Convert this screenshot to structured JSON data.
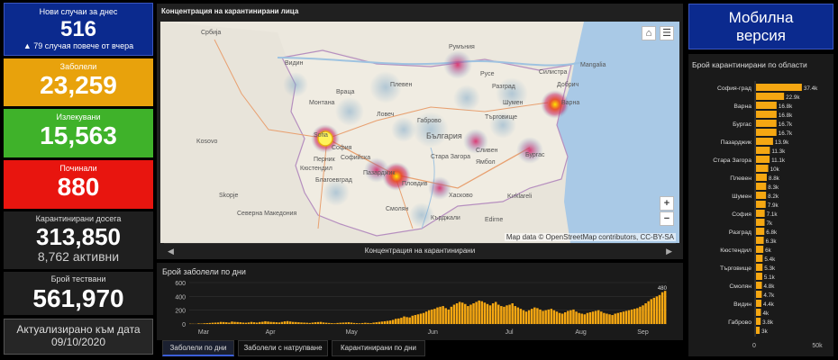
{
  "tiles": {
    "new_cases": {
      "label": "Нови случаи за днес",
      "value": "516",
      "sub": "▲ 79 случая повече от вчера",
      "color": "#0b2a8e"
    },
    "infected": {
      "label": "Заболели",
      "value": "23,259",
      "color": "#e8a20c"
    },
    "recovered": {
      "label": "Излекувани",
      "value": "15,563",
      "color": "#3fb22a"
    },
    "deceased": {
      "label": "Починали",
      "value": "880",
      "color": "#e8150f"
    },
    "quarantined": {
      "label": "Карантинирани досега",
      "value": "313,850",
      "sub": "8,762 активни"
    },
    "tests": {
      "label": "Брой тествани",
      "value": "561,970"
    },
    "updated": {
      "label": "Актуализирано към дата",
      "date": "09/10/2020"
    }
  },
  "map": {
    "title": "Концентрация на карантинирани лица",
    "credit": "Map data © OpenStreetMap contributors, CC-BY-SA",
    "nav_label": "Концентрация на карантинирани",
    "zoom_in": "+",
    "zoom_out": "−",
    "labels": [
      "Србија",
      "Румъния",
      "Плевен",
      "Враца",
      "Русе",
      "Видин",
      "Ловеч",
      "Шумен",
      "Варна",
      "България",
      "София",
      "Пловдив",
      "Бургас",
      "Sofia",
      "Софийска",
      "Kosovo",
      "Skopje",
      "Северна Македония",
      "Kırklareli",
      "Edirne",
      "Благоевград",
      "Хасково",
      "Ямбол",
      "Сливен",
      "Стара Загора",
      "Кюстендил",
      "Перник",
      "Кърджали",
      "Смолян",
      "Пазарджик",
      "Габрово",
      "Монтана",
      "Търговище",
      "Разград",
      "Силистра",
      "Добрич",
      "Mangalia"
    ]
  },
  "daily_chart": {
    "title": "Брой заболели по дни",
    "tabs": [
      "Заболели по дни",
      "Заболели с натрупване",
      "Карантинирани по дни"
    ],
    "active_tab": 0
  },
  "mobile_button": {
    "label_line1": "Мобилна",
    "label_line2": "версия"
  },
  "chart_data": [
    {
      "type": "bar",
      "title": "Брой заболели по дни",
      "x_ticks": [
        "Mar",
        "Apr",
        "May",
        "Jun",
        "Jul",
        "Aug",
        "Sep"
      ],
      "y_ticks": [
        0,
        200,
        400,
        600
      ],
      "ylim": [
        0,
        600
      ],
      "bar_color": "#f5a712",
      "values": [
        4,
        3,
        2,
        8,
        6,
        10,
        12,
        15,
        18,
        20,
        22,
        30,
        28,
        25,
        20,
        35,
        30,
        28,
        25,
        20,
        18,
        22,
        30,
        25,
        20,
        28,
        32,
        40,
        35,
        30,
        28,
        25,
        22,
        30,
        38,
        42,
        36,
        30,
        28,
        25,
        22,
        20,
        18,
        15,
        20,
        25,
        28,
        30,
        22,
        18,
        15,
        12,
        10,
        15,
        18,
        20,
        22,
        25,
        20,
        15,
        12,
        10,
        14,
        18,
        15,
        12,
        20,
        25,
        30,
        35,
        40,
        45,
        50,
        60,
        75,
        80,
        90,
        110,
        100,
        95,
        120,
        130,
        140,
        150,
        160,
        180,
        200,
        210,
        220,
        240,
        250,
        260,
        230,
        210,
        250,
        280,
        300,
        320,
        310,
        290,
        260,
        280,
        300,
        320,
        340,
        330,
        310,
        290,
        270,
        300,
        320,
        280,
        260,
        250,
        270,
        280,
        300,
        260,
        240,
        220,
        200,
        180,
        200,
        220,
        240,
        230,
        210,
        190,
        200,
        210,
        220,
        200,
        180,
        160,
        150,
        170,
        190,
        200,
        210,
        180,
        160,
        150,
        140,
        160,
        170,
        180,
        190,
        200,
        180,
        160,
        150,
        140,
        130,
        150,
        160,
        170,
        180,
        190,
        200,
        210,
        220,
        230,
        250,
        270,
        300,
        330,
        360,
        380,
        400,
        420,
        460,
        480
      ],
      "last_label": "480"
    },
    {
      "type": "bar",
      "title": "Брой карантинирани по области",
      "orientation": "horizontal",
      "visible_categories": [
        "София-град",
        "Варна",
        "Бургас",
        "Пазарджик",
        "Стара Загора",
        "Плевен",
        "Шумен",
        "София",
        "Разград",
        "Кюстендил",
        "Търговище",
        "Смолян",
        "Видин",
        "Габрово"
      ],
      "values_labels": [
        "37.4k",
        "22.9k",
        "16.8k",
        "16.8k",
        "16.7k",
        "16.7k",
        "13.9k",
        "11.3k",
        "11.1k",
        "10k",
        "8.8k",
        "8.3k",
        "8.2k",
        "7.9k",
        "7.1k",
        "7k",
        "6.8k",
        "6.3k",
        "6k",
        "5.4k",
        "5.3k",
        "5.1k",
        "4.8k",
        "4.7k",
        "4.4k",
        "4k",
        "3.8k",
        "3k"
      ],
      "values": [
        37.4,
        22.9,
        16.8,
        16.8,
        16.7,
        16.7,
        13.9,
        11.3,
        11.1,
        10,
        8.8,
        8.3,
        8.2,
        7.9,
        7.1,
        7,
        6.8,
        6.3,
        6,
        5.4,
        5.3,
        5.1,
        4.8,
        4.7,
        4.4,
        4,
        3.8,
        3
      ],
      "x_ticks": [
        "0",
        "50k"
      ],
      "xlim": [
        0,
        50
      ],
      "bar_color": "#f5a712"
    }
  ]
}
